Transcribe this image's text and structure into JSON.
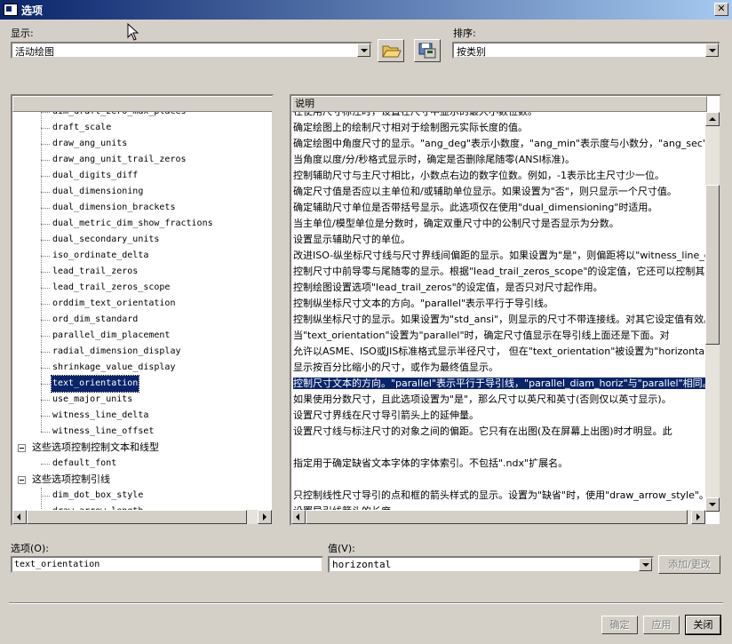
{
  "window": {
    "title": "选项",
    "close_glyph": "✕"
  },
  "display": {
    "label": "显示:",
    "value": "活动绘图"
  },
  "sort": {
    "label": "排序:",
    "value": "按类别"
  },
  "toolbar": {
    "open_icon": "folder-open-icon",
    "save_icon": "save-apply-icon"
  },
  "table": {
    "header_desc": "说明"
  },
  "tree_items": [
    {
      "name": "dim_draft_zero_max_places",
      "desc": "在使用尺寸标注时，设置在尺寸中显示的最大小数位数。"
    },
    {
      "name": "draft_scale",
      "desc": "确定绘图上的绘制尺寸相对于绘制图元实际长度的值。"
    },
    {
      "name": "draw_ang_units",
      "desc": "确定绘图中角度尺寸的显示。\"ang_deg\"表示小数度，\"ang_min\"表示度与小数分，\"ang_sec\"表示度分秒。"
    },
    {
      "name": "draw_ang_unit_trail_zeros",
      "desc": "当角度以度/分/秒格式显示时，确定是否删除尾随零(ANSI标准)。"
    },
    {
      "name": "dual_digits_diff",
      "desc": "控制辅助尺寸与主尺寸相比，小数点右边的数字位数。例如，-1表示比主尺寸少一位。"
    },
    {
      "name": "dual_dimensioning",
      "desc": "确定尺寸值是否应以主单位和/或辅助单位显示。如果设置为\"否\"，则只显示一个尺寸值。"
    },
    {
      "name": "dual_dimension_brackets",
      "desc": "确定辅助尺寸单位是否带括号显示。此选项仅在使用\"dual_dimensioning\"时适用。"
    },
    {
      "name": "dual_metric_dim_show_fractions",
      "desc": "当主单位/模型单位是分数时，确定双重尺寸中的公制尺寸是否显示为分数。"
    },
    {
      "name": "dual_secondary_units",
      "desc": "设置显示辅助尺寸的单位。"
    },
    {
      "name": "iso_ordinate_delta",
      "desc": "改进ISO-纵坐标尺寸线与尺寸界线间偏距的显示。如果设置为\"是\"，则偏距将以\"witness_line_delta\"为准。"
    },
    {
      "name": "lead_trail_zeros",
      "desc": "控制尺寸中前导零与尾随零的显示。根据\"lead_trail_zeros_scope\"的设定值，它还可以控制其它值。"
    },
    {
      "name": "lead_trail_zeros_scope",
      "desc": "控制绘图设置选项\"lead_trail_zeros\"的设定值，是否只对尺寸起作用。"
    },
    {
      "name": "orddim_text_orientation",
      "desc": "控制纵坐标尺寸文本的方向。\"parallel\"表示平行于导引线。"
    },
    {
      "name": "ord_dim_standard",
      "desc": "控制纵坐标尺寸的显示。如果设置为\"std_ansi\"，则显示的尺寸不带连接线。对其它设定值有效。"
    },
    {
      "name": "parallel_dim_placement",
      "desc": "当\"text_orientation\"设置为\"parallel\"时，确定尺寸值显示在导引线上面还是下面。对"
    },
    {
      "name": "radial_dimension_display",
      "desc": "允许以ASME、ISO或JIS标准格式显示半径尺寸， 但在\"text_orientation\"被设置为\"horizontal\"时。"
    },
    {
      "name": "shrinkage_value_display",
      "desc": "显示按百分比缩小的尺寸，或作为最终值显示。"
    },
    {
      "name": "text_orientation",
      "desc": "控制尺寸文本的方向。\"parallel\"表示平行于导引线，\"parallel_diam_horiz\"与\"parallel\"相同。"
    },
    {
      "name": "use_major_units",
      "desc": "如果使用分数尺寸，且此选项设置为\"是\"，那么尺寸以英尺和英寸(否则仅以英寸显示)。"
    },
    {
      "name": "witness_line_delta",
      "desc": "设置尺寸界线在尺寸导引箭头上的延伸量。"
    },
    {
      "name": "witness_line_offset",
      "desc": "设置尺寸线与标注尺寸的对象之间的偏距。它只有在出图(及在屏幕上出图)时才明显。此"
    }
  ],
  "group_text": {
    "label": "这些选项控制控制文本和线型"
  },
  "default_font": {
    "name": "default_font",
    "desc": "指定用于确定缺省文本字体的字体索引。不包括\".ndx\"扩展名。"
  },
  "group_leader": {
    "label": "这些选项控制引线"
  },
  "leader_items": [
    {
      "name": "dim_dot_box_style",
      "desc": "只控制线性尺寸导引的点和框的箭头样式的显示。设置为\"缺省\"时，使用\"draw_arrow_style\"。"
    },
    {
      "name": "draw_arrow_length",
      "desc": "设置导引线箭头的长度。"
    }
  ],
  "option": {
    "label": "选项(O):",
    "value": "text_orientation"
  },
  "value_field": {
    "label": "值(V):",
    "value": "horizontal"
  },
  "buttons": {
    "add_change": "添加/更改",
    "ok": "确定",
    "apply": "应用",
    "close": "关闭"
  }
}
